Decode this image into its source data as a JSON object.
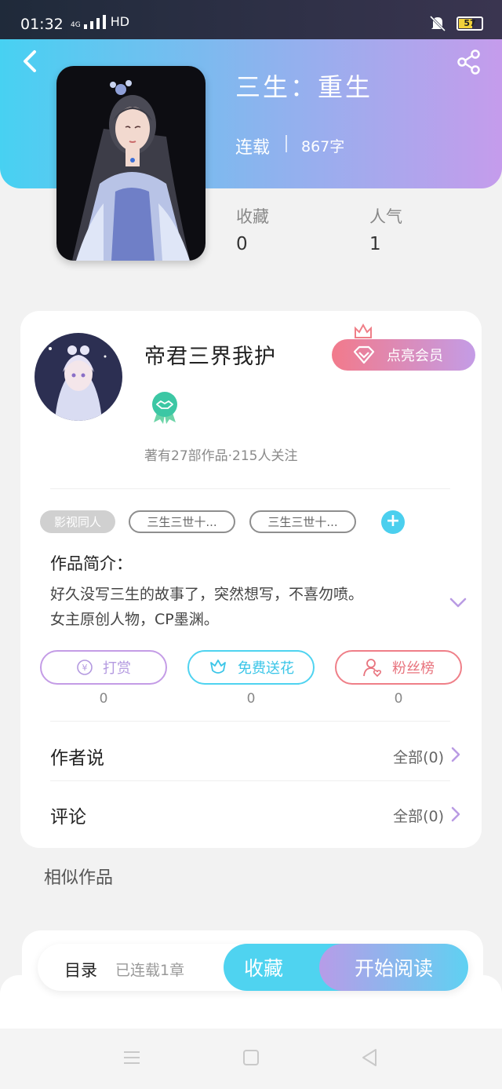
{
  "status_bar": {
    "time": "01:32",
    "network": "4G",
    "hd": "HD",
    "battery": "57"
  },
  "book": {
    "title": "三生：重生",
    "status": "连载",
    "word_count": "867字",
    "stats": {
      "favorites_label": "收藏",
      "favorites_value": "0",
      "popularity_label": "人气",
      "popularity_value": "1"
    }
  },
  "author": {
    "name": "帝君三界我护",
    "vip_button": "点亮会员",
    "stats": "著有27部作品·215人关注"
  },
  "tags": [
    "影视同人",
    "三生三世十...",
    "三生三世十..."
  ],
  "intro": {
    "heading": "作品简介：",
    "lines": [
      "好久没写三生的故事了，突然想写，不喜勿喷。",
      "女主原创人物，CP墨渊。"
    ]
  },
  "actions": [
    {
      "label": "打赏",
      "count": "0",
      "color": "#c49ce6"
    },
    {
      "label": "免费送花",
      "count": "0",
      "color": "#4fd3f0"
    },
    {
      "label": "粉丝榜",
      "count": "0",
      "color": "#ef7f88"
    }
  ],
  "rows": [
    {
      "title": "作者说",
      "right": "全部(0)"
    },
    {
      "title": "评论",
      "right": "全部(0)"
    }
  ],
  "similar": {
    "title": "相似作品"
  },
  "bottom_bar": {
    "toc": "目录",
    "serial_count": "已连载1章",
    "favorite": "收藏",
    "start_reading": "开始阅读"
  },
  "colors": {
    "accent_cyan": "#4fd3f0",
    "accent_purple": "#c49ce6",
    "accent_pink": "#ef7f88"
  }
}
